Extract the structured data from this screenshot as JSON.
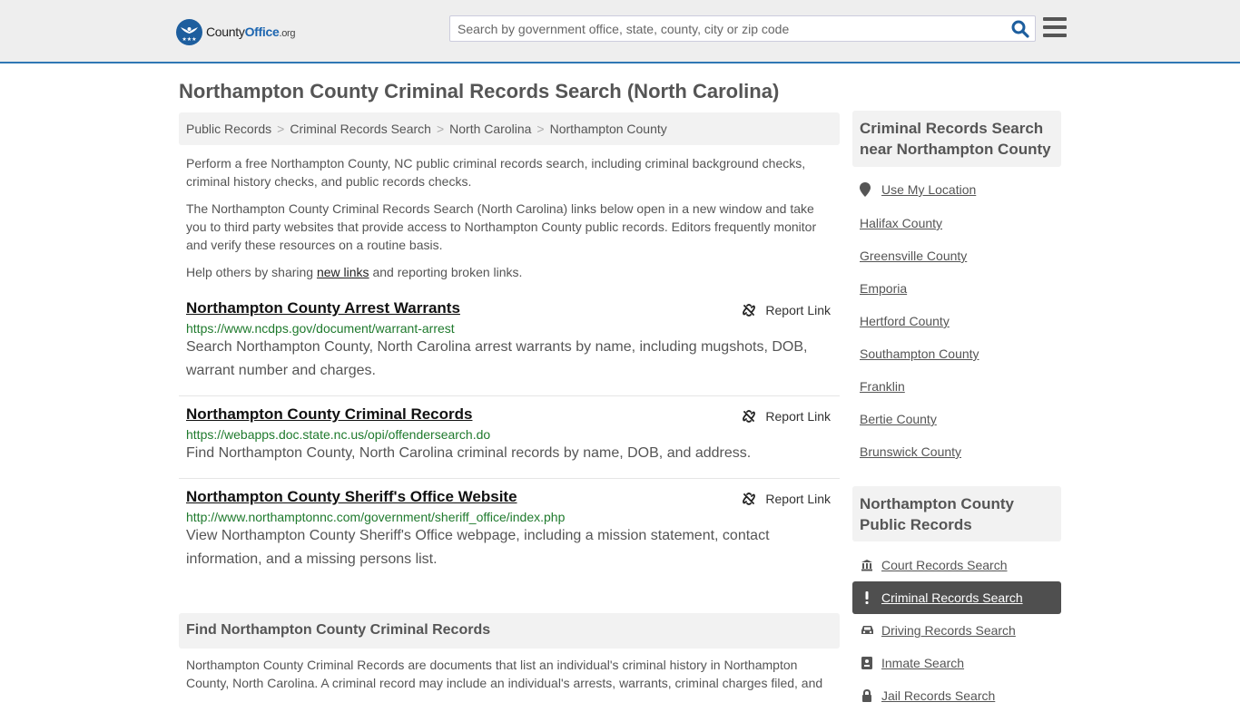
{
  "header": {
    "logo": {
      "name_part1": "County",
      "name_part2": "Office",
      "tld": ".org"
    },
    "search": {
      "placeholder": "Search by government office, state, county, city or zip code",
      "value": ""
    },
    "search_icon": "search-icon",
    "menu_icon": "hamburger-menu-icon"
  },
  "page": {
    "title": "Northampton County Criminal Records Search (North Carolina)"
  },
  "breadcrumb": [
    {
      "label": "Public Records"
    },
    {
      "label": "Criminal Records Search"
    },
    {
      "label": "North Carolina"
    },
    {
      "label": "Northampton County"
    }
  ],
  "breadcrumb_separator": ">",
  "intro": {
    "p1": "Perform a free Northampton County, NC public criminal records search, including criminal background checks, criminal history checks, and public records checks.",
    "p2": "The Northampton County Criminal Records Search (North Carolina) links below open in a new window and take you to third party websites that provide access to Northampton County public records. Editors frequently monitor and verify these resources on a routine basis.",
    "p3_before": "Help others by sharing ",
    "p3_link": "new links",
    "p3_after": " and reporting broken links."
  },
  "results": [
    {
      "title": "Northampton County Arrest Warrants",
      "url": "https://www.ncdps.gov/document/warrant-arrest",
      "description": "Search Northampton County, North Carolina arrest warrants by name, including mugshots, DOB, warrant number and charges.",
      "report_label": "Report Link"
    },
    {
      "title": "Northampton County Criminal Records",
      "url": "https://webapps.doc.state.nc.us/opi/offendersearch.do",
      "description": "Find Northampton County, North Carolina criminal records by name, DOB, and address.",
      "report_label": "Report Link"
    },
    {
      "title": "Northampton County Sheriff's Office Website",
      "url": "http://www.northamptonnc.com/government/sheriff_office/index.php",
      "description": "View Northampton County Sheriff's Office webpage, including a mission statement, contact information, and a missing persons list.",
      "report_label": "Report Link"
    }
  ],
  "find_section": {
    "heading": "Find Northampton County Criminal Records",
    "text": "Northampton County Criminal Records are documents that list an individual's criminal history in Northampton County, North Carolina. A criminal record may include an individual's arrests, warrants, criminal charges filed, and"
  },
  "sidebar": {
    "nearby": {
      "heading": "Criminal Records Search near Northampton County",
      "use_location": "Use My Location",
      "links": [
        "Halifax County",
        "Greensville County",
        "Emporia",
        "Hertford County",
        "Southampton County",
        "Franklin",
        "Bertie County",
        "Brunswick County"
      ]
    },
    "public_records": {
      "heading": "Northampton County Public Records",
      "items": [
        {
          "label": "Court Records Search",
          "icon": "courthouse-icon",
          "active": false
        },
        {
          "label": "Criminal Records Search",
          "icon": "exclamation-icon",
          "active": true
        },
        {
          "label": "Driving Records Search",
          "icon": "car-icon",
          "active": false
        },
        {
          "label": "Inmate Search",
          "icon": "id-badge-icon",
          "active": false
        },
        {
          "label": "Jail Records Search",
          "icon": "lock-icon",
          "active": false
        }
      ]
    }
  },
  "colors": {
    "accent_blue": "#2f77b4",
    "url_green": "#1f7a2d",
    "active_item_bg": "#4f4f4f",
    "panel_bg": "#f2f2f2"
  }
}
